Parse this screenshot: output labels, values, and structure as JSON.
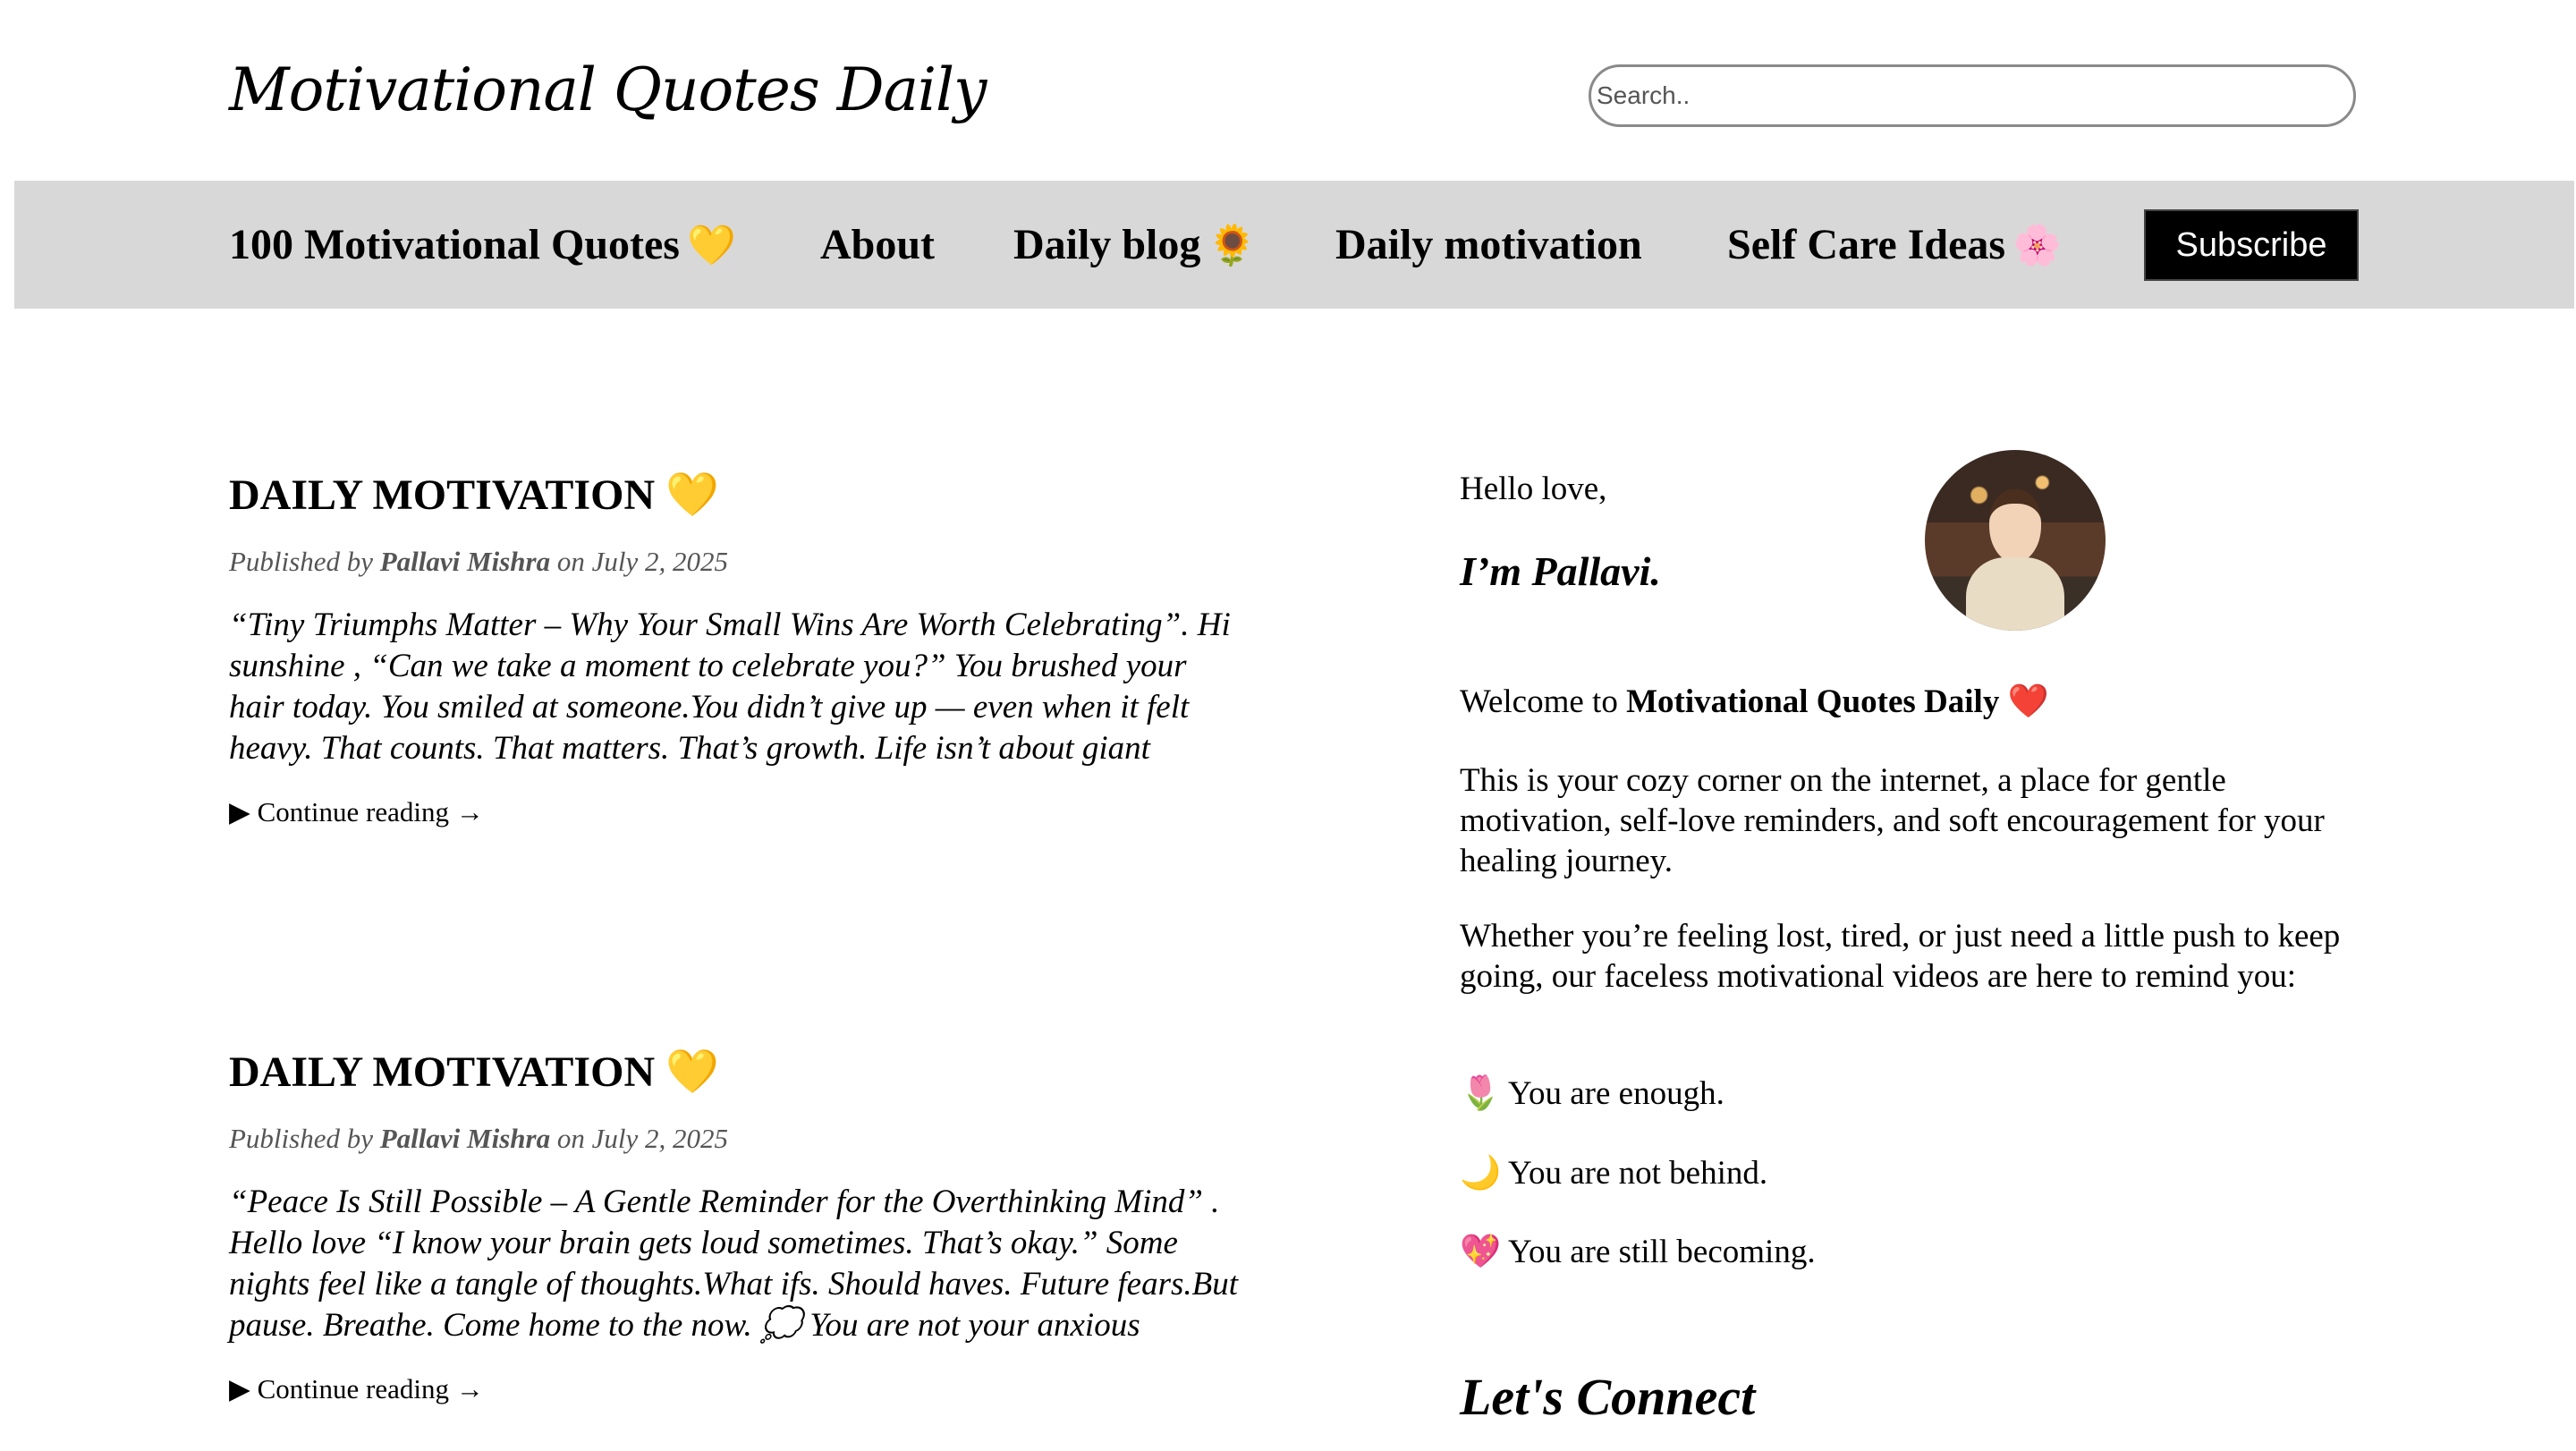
{
  "header": {
    "site_title": "Motivational Quotes Daily",
    "search_placeholder": "Search.."
  },
  "nav": {
    "items": [
      {
        "label": "100 Motivational Quotes",
        "emoji": "💛"
      },
      {
        "label": "About",
        "emoji": ""
      },
      {
        "label": "Daily blog",
        "emoji": "🌻"
      },
      {
        "label": "Daily motivation",
        "emoji": ""
      },
      {
        "label": "Self Care Ideas",
        "emoji": "🌸"
      }
    ],
    "subscribe_label": "Subscribe"
  },
  "posts": [
    {
      "title": "DAILY MOTIVATION 💛",
      "published_prefix": "Published by",
      "author": "Pallavi Mishra",
      "date_prefix": "on",
      "date": "July 2, 2025",
      "excerpt": "“Tiny Triumphs Matter – Why Your Small Wins Are Worth Celebrating”. Hi sunshine , “Can we take a moment to celebrate you?” You brushed your hair today. You smiled at someone.You didn’t give up — even when it felt heavy. That counts. That matters. That’s growth. Life isn’t about giant",
      "continue_label": "▶ Continue reading →"
    },
    {
      "title": "DAILY MOTIVATION 💛",
      "published_prefix": "Published by",
      "author": "Pallavi Mishra",
      "date_prefix": "on",
      "date": "July 2, 2025",
      "excerpt": "“Peace Is Still Possible – A Gentle Reminder for the Overthinking Mind” . Hello love “I know your brain gets loud sometimes. That’s okay.” Some nights feel like a tangle of thoughts.What ifs. Should haves. Future fears.But pause. Breathe. Come home to the now. 💭 You are not your anxious",
      "continue_label": "▶ Continue reading →"
    }
  ],
  "sidebar": {
    "greeting": "Hello love,",
    "name_line": "I’m Pallavi.",
    "welcome_prefix": "Welcome to",
    "welcome_bold": "Motivational Quotes Daily",
    "welcome_emoji": "❤️",
    "para1": "This is your cozy corner on the internet, a place for gentle motivation, self-love reminders, and soft encouragement for your healing journey.",
    "para2": "Whether you’re feeling lost, tired, or just need a little push to keep going, our faceless motivational videos are here to remind you:",
    "affirmations": [
      {
        "emoji": "🌷",
        "text": "You are enough."
      },
      {
        "emoji": "🌙",
        "text": "You are not behind."
      },
      {
        "emoji": "💖",
        "text": "You are still becoming."
      }
    ],
    "connect_title": "Let's Connect"
  }
}
